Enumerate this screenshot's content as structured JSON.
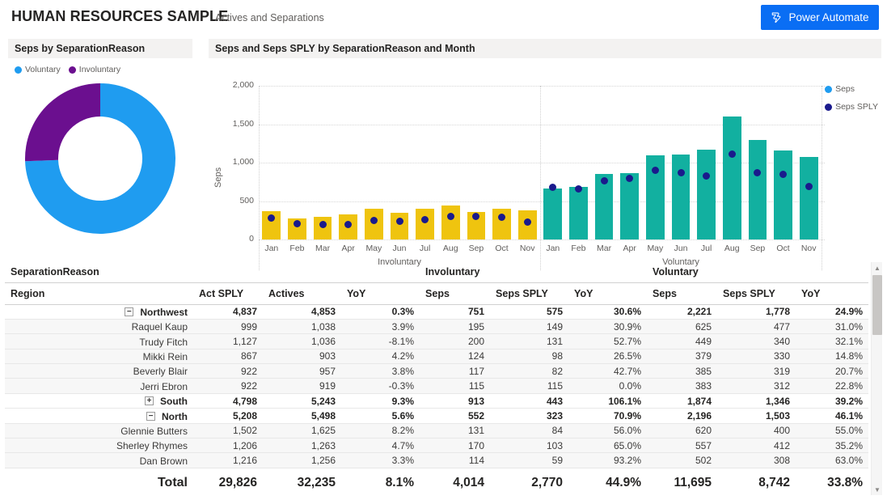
{
  "header": {
    "title": "HUMAN RESOURCES SAMPLE",
    "subtitle": "Actives and Separations",
    "power_automate_label": "Power Automate",
    "power_automate_icon": "power-automate-icon",
    "accent_blue": "#0a6ef4"
  },
  "donut_card": {
    "title": "Seps by SeparationReason",
    "legend": [
      {
        "label": "Voluntary",
        "color": "#1f9cf0"
      },
      {
        "label": "Involuntary",
        "color": "#6b0f8f"
      }
    ]
  },
  "bar_card": {
    "title": "Seps and Seps SPLY by SeparationReason and Month",
    "legend": [
      {
        "label": "Seps",
        "color": "#1f9cf0"
      },
      {
        "label": "Seps SPLY",
        "color": "#1a1a8c"
      }
    ]
  },
  "chart_data": [
    {
      "type": "pie",
      "title": "Seps by SeparationReason",
      "subtype": "donut",
      "legend_position": "top-left",
      "labels": [
        "Voluntary",
        "Involuntary"
      ],
      "values": [
        11695,
        4014
      ],
      "percentages": [
        74.4,
        25.6
      ],
      "colors": [
        "#1f9cf0",
        "#6b0f8f"
      ]
    },
    {
      "type": "bar",
      "title": "Seps and Seps SPLY by SeparationReason and Month",
      "xlabel": "",
      "ylabel": "Seps",
      "ylim": [
        0,
        2000
      ],
      "yticks": [
        0,
        500,
        1000,
        1500,
        2000
      ],
      "ytick_labels": [
        "0",
        "500",
        "1,000",
        "1,500",
        "2,000"
      ],
      "grid": true,
      "legend_position": "right",
      "groups": [
        "Involuntary",
        "Voluntary"
      ],
      "categories": [
        "Jan",
        "Feb",
        "Mar",
        "Apr",
        "May",
        "Jun",
        "Jul",
        "Aug",
        "Sep",
        "Oct",
        "Nov"
      ],
      "series": [
        {
          "name": "Seps",
          "render": "bar",
          "group_colors": {
            "Involuntary": "#efc40f",
            "Voluntary": "#12b0a0"
          },
          "data": {
            "Involuntary": [
              370,
              275,
              290,
              330,
              405,
              345,
              400,
              440,
              355,
              405,
              375
            ],
            "Voluntary": [
              660,
              680,
              850,
              860,
              1100,
              1105,
              1165,
              1605,
              1300,
              1155,
              1075
            ]
          }
        },
        {
          "name": "Seps SPLY",
          "render": "marker",
          "color": "#1a1a8c",
          "data": {
            "Involuntary": [
              280,
              205,
              200,
              190,
              245,
              235,
              255,
              300,
              305,
              285,
              230
            ],
            "Voluntary": [
              680,
              660,
              760,
              790,
              905,
              865,
              830,
              1110,
              865,
              845,
              685
            ]
          }
        }
      ]
    }
  ],
  "matrix": {
    "row_header_1": "SeparationReason",
    "row_header_2": "Region",
    "group_headers": [
      "",
      "Involuntary",
      "Voluntary"
    ],
    "measure_headers": [
      "Act SPLY",
      "Actives",
      "YoY",
      "Seps",
      "Seps SPLY",
      "YoY",
      "Seps",
      "Seps SPLY",
      "YoY"
    ],
    "rows": [
      {
        "label": "Northwest",
        "level": 0,
        "expander": "minus",
        "values": [
          "4,837",
          "4,853",
          "0.3%",
          "751",
          "575",
          "30.6%",
          "2,221",
          "1,778",
          "24.9%"
        ]
      },
      {
        "label": "Raquel Kaup",
        "level": 1,
        "expander": "none",
        "values": [
          "999",
          "1,038",
          "3.9%",
          "195",
          "149",
          "30.9%",
          "625",
          "477",
          "31.0%"
        ]
      },
      {
        "label": "Trudy Fitch",
        "level": 1,
        "expander": "none",
        "values": [
          "1,127",
          "1,036",
          "-8.1%",
          "200",
          "131",
          "52.7%",
          "449",
          "340",
          "32.1%"
        ]
      },
      {
        "label": "Mikki Rein",
        "level": 1,
        "expander": "none",
        "values": [
          "867",
          "903",
          "4.2%",
          "124",
          "98",
          "26.5%",
          "379",
          "330",
          "14.8%"
        ]
      },
      {
        "label": "Beverly Blair",
        "level": 1,
        "expander": "none",
        "values": [
          "922",
          "957",
          "3.8%",
          "117",
          "82",
          "42.7%",
          "385",
          "319",
          "20.7%"
        ]
      },
      {
        "label": "Jerri Ebron",
        "level": 1,
        "expander": "none",
        "values": [
          "922",
          "919",
          "-0.3%",
          "115",
          "115",
          "0.0%",
          "383",
          "312",
          "22.8%"
        ]
      },
      {
        "label": "South",
        "level": 0,
        "expander": "plus",
        "values": [
          "4,798",
          "5,243",
          "9.3%",
          "913",
          "443",
          "106.1%",
          "1,874",
          "1,346",
          "39.2%"
        ]
      },
      {
        "label": "North",
        "level": 0,
        "expander": "minus",
        "values": [
          "5,208",
          "5,498",
          "5.6%",
          "552",
          "323",
          "70.9%",
          "2,196",
          "1,503",
          "46.1%"
        ]
      },
      {
        "label": "Glennie Butters",
        "level": 1,
        "expander": "none",
        "values": [
          "1,502",
          "1,625",
          "8.2%",
          "131",
          "84",
          "56.0%",
          "620",
          "400",
          "55.0%"
        ]
      },
      {
        "label": "Sherley Rhymes",
        "level": 1,
        "expander": "none",
        "values": [
          "1,206",
          "1,263",
          "4.7%",
          "170",
          "103",
          "65.0%",
          "557",
          "412",
          "35.2%"
        ]
      },
      {
        "label": "Dan Brown",
        "level": 1,
        "expander": "none",
        "values": [
          "1,216",
          "1,256",
          "3.3%",
          "114",
          "59",
          "93.2%",
          "502",
          "308",
          "63.0%"
        ]
      }
    ],
    "total_row": {
      "label": "Total",
      "values": [
        "29,826",
        "32,235",
        "8.1%",
        "4,014",
        "2,770",
        "44.9%",
        "11,695",
        "8,742",
        "33.8%"
      ]
    },
    "scrollbar": {
      "up_icon": "chevron-up-icon",
      "down_icon": "chevron-down-icon"
    }
  }
}
